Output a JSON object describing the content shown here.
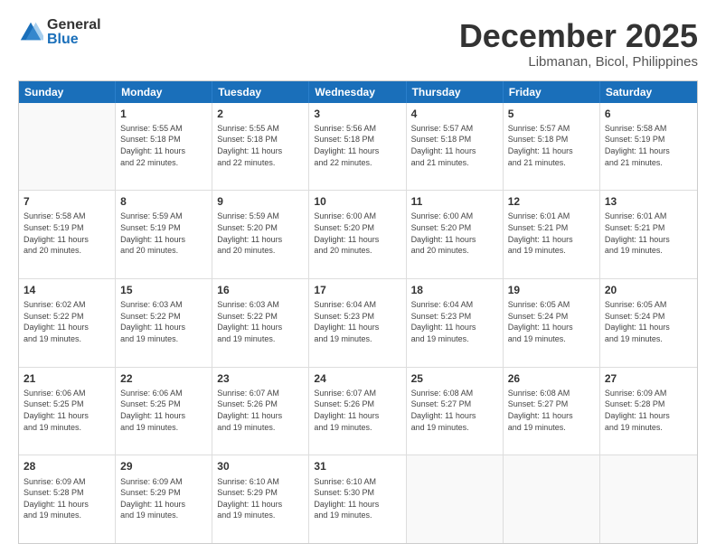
{
  "logo": {
    "general": "General",
    "blue": "Blue"
  },
  "title": "December 2025",
  "location": "Libmanan, Bicol, Philippines",
  "weekdays": [
    "Sunday",
    "Monday",
    "Tuesday",
    "Wednesday",
    "Thursday",
    "Friday",
    "Saturday"
  ],
  "weeks": [
    [
      {
        "day": "",
        "info": ""
      },
      {
        "day": "1",
        "info": "Sunrise: 5:55 AM\nSunset: 5:18 PM\nDaylight: 11 hours\nand 22 minutes."
      },
      {
        "day": "2",
        "info": "Sunrise: 5:55 AM\nSunset: 5:18 PM\nDaylight: 11 hours\nand 22 minutes."
      },
      {
        "day": "3",
        "info": "Sunrise: 5:56 AM\nSunset: 5:18 PM\nDaylight: 11 hours\nand 22 minutes."
      },
      {
        "day": "4",
        "info": "Sunrise: 5:57 AM\nSunset: 5:18 PM\nDaylight: 11 hours\nand 21 minutes."
      },
      {
        "day": "5",
        "info": "Sunrise: 5:57 AM\nSunset: 5:18 PM\nDaylight: 11 hours\nand 21 minutes."
      },
      {
        "day": "6",
        "info": "Sunrise: 5:58 AM\nSunset: 5:19 PM\nDaylight: 11 hours\nand 21 minutes."
      }
    ],
    [
      {
        "day": "7",
        "info": "Sunrise: 5:58 AM\nSunset: 5:19 PM\nDaylight: 11 hours\nand 20 minutes."
      },
      {
        "day": "8",
        "info": "Sunrise: 5:59 AM\nSunset: 5:19 PM\nDaylight: 11 hours\nand 20 minutes."
      },
      {
        "day": "9",
        "info": "Sunrise: 5:59 AM\nSunset: 5:20 PM\nDaylight: 11 hours\nand 20 minutes."
      },
      {
        "day": "10",
        "info": "Sunrise: 6:00 AM\nSunset: 5:20 PM\nDaylight: 11 hours\nand 20 minutes."
      },
      {
        "day": "11",
        "info": "Sunrise: 6:00 AM\nSunset: 5:20 PM\nDaylight: 11 hours\nand 20 minutes."
      },
      {
        "day": "12",
        "info": "Sunrise: 6:01 AM\nSunset: 5:21 PM\nDaylight: 11 hours\nand 19 minutes."
      },
      {
        "day": "13",
        "info": "Sunrise: 6:01 AM\nSunset: 5:21 PM\nDaylight: 11 hours\nand 19 minutes."
      }
    ],
    [
      {
        "day": "14",
        "info": "Sunrise: 6:02 AM\nSunset: 5:22 PM\nDaylight: 11 hours\nand 19 minutes."
      },
      {
        "day": "15",
        "info": "Sunrise: 6:03 AM\nSunset: 5:22 PM\nDaylight: 11 hours\nand 19 minutes."
      },
      {
        "day": "16",
        "info": "Sunrise: 6:03 AM\nSunset: 5:22 PM\nDaylight: 11 hours\nand 19 minutes."
      },
      {
        "day": "17",
        "info": "Sunrise: 6:04 AM\nSunset: 5:23 PM\nDaylight: 11 hours\nand 19 minutes."
      },
      {
        "day": "18",
        "info": "Sunrise: 6:04 AM\nSunset: 5:23 PM\nDaylight: 11 hours\nand 19 minutes."
      },
      {
        "day": "19",
        "info": "Sunrise: 6:05 AM\nSunset: 5:24 PM\nDaylight: 11 hours\nand 19 minutes."
      },
      {
        "day": "20",
        "info": "Sunrise: 6:05 AM\nSunset: 5:24 PM\nDaylight: 11 hours\nand 19 minutes."
      }
    ],
    [
      {
        "day": "21",
        "info": "Sunrise: 6:06 AM\nSunset: 5:25 PM\nDaylight: 11 hours\nand 19 minutes."
      },
      {
        "day": "22",
        "info": "Sunrise: 6:06 AM\nSunset: 5:25 PM\nDaylight: 11 hours\nand 19 minutes."
      },
      {
        "day": "23",
        "info": "Sunrise: 6:07 AM\nSunset: 5:26 PM\nDaylight: 11 hours\nand 19 minutes."
      },
      {
        "day": "24",
        "info": "Sunrise: 6:07 AM\nSunset: 5:26 PM\nDaylight: 11 hours\nand 19 minutes."
      },
      {
        "day": "25",
        "info": "Sunrise: 6:08 AM\nSunset: 5:27 PM\nDaylight: 11 hours\nand 19 minutes."
      },
      {
        "day": "26",
        "info": "Sunrise: 6:08 AM\nSunset: 5:27 PM\nDaylight: 11 hours\nand 19 minutes."
      },
      {
        "day": "27",
        "info": "Sunrise: 6:09 AM\nSunset: 5:28 PM\nDaylight: 11 hours\nand 19 minutes."
      }
    ],
    [
      {
        "day": "28",
        "info": "Sunrise: 6:09 AM\nSunset: 5:28 PM\nDaylight: 11 hours\nand 19 minutes."
      },
      {
        "day": "29",
        "info": "Sunrise: 6:09 AM\nSunset: 5:29 PM\nDaylight: 11 hours\nand 19 minutes."
      },
      {
        "day": "30",
        "info": "Sunrise: 6:10 AM\nSunset: 5:29 PM\nDaylight: 11 hours\nand 19 minutes."
      },
      {
        "day": "31",
        "info": "Sunrise: 6:10 AM\nSunset: 5:30 PM\nDaylight: 11 hours\nand 19 minutes."
      },
      {
        "day": "",
        "info": ""
      },
      {
        "day": "",
        "info": ""
      },
      {
        "day": "",
        "info": ""
      }
    ]
  ]
}
